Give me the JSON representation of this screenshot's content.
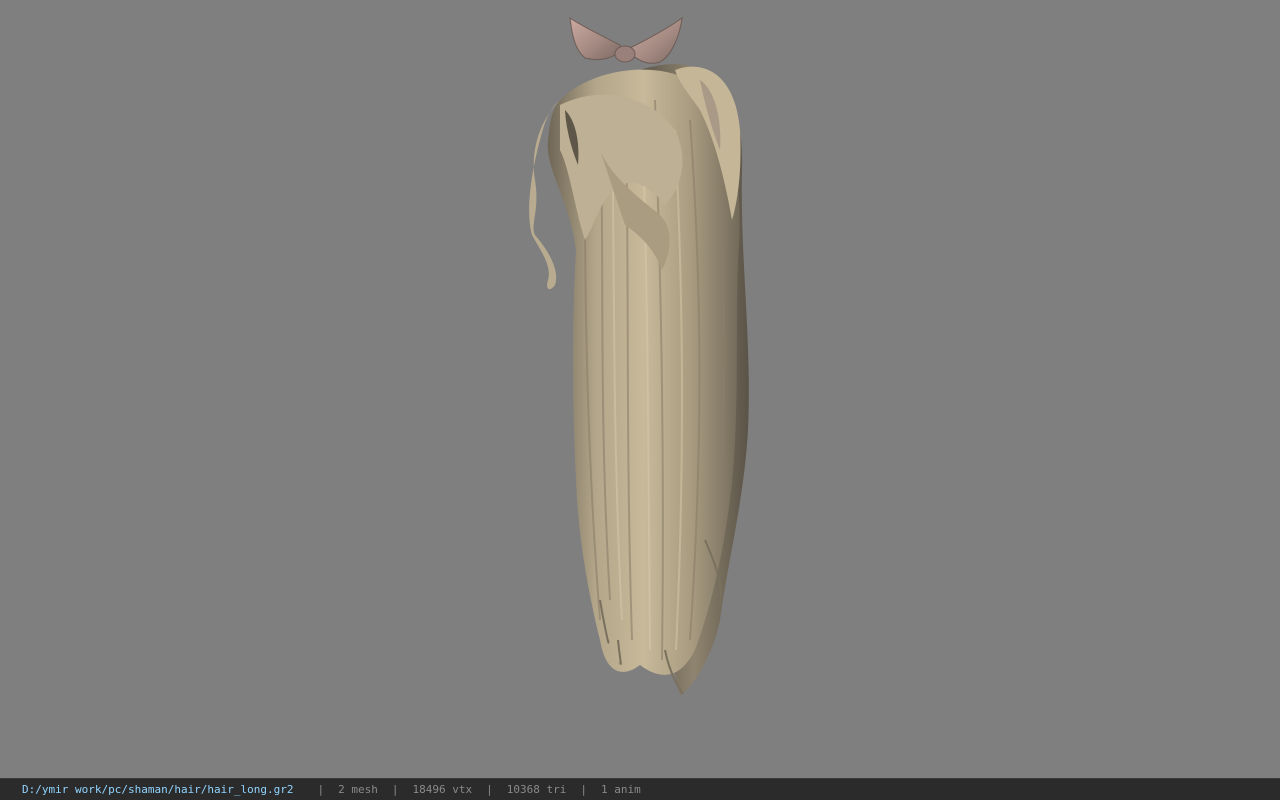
{
  "viewer": {
    "background_color": "#7f7f7f",
    "model_description_icon": "long-ponytail-hair-mesh"
  },
  "status_bar": {
    "file_path": "D:/ymir work/pc/shaman/hair/hair_long.gr2",
    "separator": "|",
    "mesh_count": "2 mesh",
    "vertex_count": "18496 vtx",
    "triangle_count": "10368 tri",
    "anim_count": "1 anim",
    "path_color": "#8fd3ff",
    "bar_color": "#2b2b2b"
  }
}
